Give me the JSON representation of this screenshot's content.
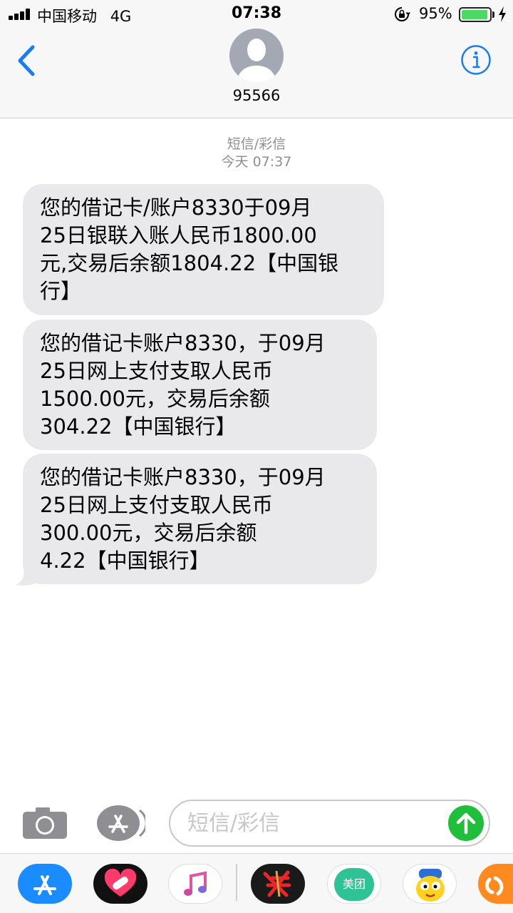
{
  "status_bar": {
    "carrier": "中国移动",
    "network": "4G",
    "time": "07:38",
    "battery_percent": "95%",
    "battery_level": 0.95,
    "battery_color": "#4cd964"
  },
  "header": {
    "contact": "95566",
    "back_icon": "chevron-left-icon",
    "info_icon": "info-icon",
    "accent_color": "#1a7cf5"
  },
  "conversation": {
    "service": "短信/彩信",
    "timestamp": "今天 07:37",
    "messages": [
      {
        "text": "您的借记卡/账户8330于09月\n25日银联入账人民币1800.00\n元,交易后余额1804.22【中国银\n行】"
      },
      {
        "text": "您的借记卡账户8330，于09月\n25日网上支付支取人民币\n1500.00元，交易后余额\n304.22【中国银行】"
      },
      {
        "text": "您的借记卡账户8330，于09月\n25日网上支付支取人民币\n300.00元，交易后余额\n4.22【中国银行】"
      }
    ]
  },
  "input_bar": {
    "placeholder": "短信/彩信",
    "value": "",
    "camera_icon": "camera-icon",
    "appstore_icon": "appstore-icon",
    "send_icon": "arrow-up-icon",
    "send_color": "#1fbf3b"
  },
  "app_drawer": {
    "apps": [
      {
        "name": "appstore-icon"
      },
      {
        "name": "heart-bandage-icon"
      },
      {
        "name": "music-note-icon"
      },
      {
        "name": "game-calligraphy-icon"
      },
      {
        "name": "meituan-icon",
        "label": "美团"
      },
      {
        "name": "cartoon-character-icon"
      },
      {
        "name": "uc-browser-icon"
      }
    ]
  }
}
